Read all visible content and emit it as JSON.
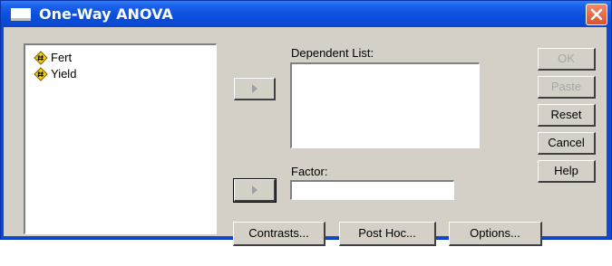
{
  "window": {
    "title": "One-Way ANOVA",
    "title_icon": "window-icon",
    "close_icon": "close-icon"
  },
  "variables": [
    {
      "name": "Fert",
      "icon": "numeric-variable-icon"
    },
    {
      "name": "Yield",
      "icon": "numeric-variable-icon"
    }
  ],
  "dependent": {
    "label": "Dependent List:",
    "move_icon": "right-arrow-icon"
  },
  "factor": {
    "label": "Factor:",
    "value": "",
    "move_icon": "right-arrow-icon"
  },
  "side_buttons": {
    "ok": "OK",
    "paste": "Paste",
    "reset": "Reset",
    "cancel": "Cancel",
    "help": "Help"
  },
  "bottom_buttons": {
    "contrasts": "Contrasts...",
    "post_hoc": "Post Hoc...",
    "options": "Options..."
  },
  "colors": {
    "titlebar": "#0a4ad6",
    "dialog_face": "#d4d0c8",
    "close_button": "#e0603a",
    "variable_icon": "#f5d000"
  }
}
